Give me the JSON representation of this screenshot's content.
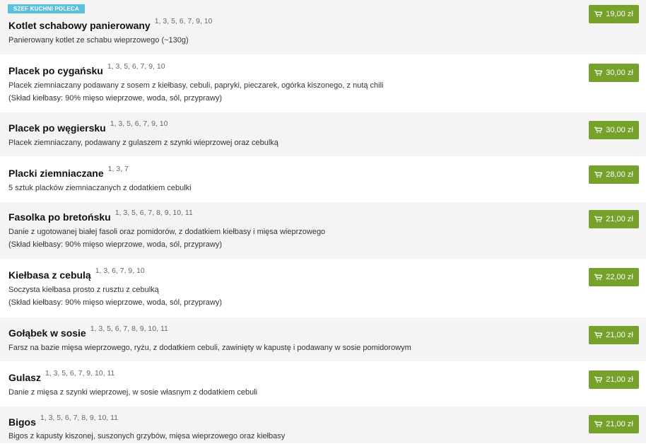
{
  "badge": "SZEF KUCHNI POLECA",
  "items": [
    {
      "name": "Kotlet schabowy panierowany",
      "allergens": "1, 3, 5, 6, 7, 9, 10",
      "desc": [
        "Panierowany kotlet ze schabu wieprzowego (~130g)"
      ],
      "price": "19,00 zł"
    },
    {
      "name": "Placek po cygańsku",
      "allergens": "1, 3, 5, 6, 7, 9, 10",
      "desc": [
        "Placek ziemniaczany podawany z sosem z kiełbasy, cebuli, papryki, pieczarek, ogórka kiszonego, z nutą chili",
        "(Skład kiełbasy: 90% mięso wieprzowe, woda, sól, przyprawy)"
      ],
      "price": "30,00 zł"
    },
    {
      "name": "Placek po węgiersku",
      "allergens": "1, 3, 5, 6, 7, 9, 10",
      "desc": [
        "Placek ziemniaczany, podawany z gulaszem z szynki wieprzowej oraz cebulką"
      ],
      "price": "30,00 zł"
    },
    {
      "name": "Placki ziemniaczane",
      "allergens": "1, 3, 7",
      "desc": [
        "5 sztuk placków ziemniaczanych z dodatkiem cebulki"
      ],
      "price": "28,00 zł"
    },
    {
      "name": "Fasolka po bretońsku",
      "allergens": "1, 3, 5, 6, 7, 8, 9, 10, 11",
      "desc": [
        "Danie z ugotowanej białej fasoli oraz pomidorów, z dodatkiem kiełbasy i mięsa wieprzowego",
        "(Skład kiełbasy: 90% mięso wieprzowe, woda, sól, przyprawy)"
      ],
      "price": "21,00 zł"
    },
    {
      "name": "Kiełbasa z cebulą",
      "allergens": "1, 3, 6, 7, 9, 10",
      "desc": [
        "Soczysta kiełbasa prosto z rusztu z cebulką",
        "(Skład kiełbasy: 90% mięso wieprzowe, woda, sól, przyprawy)"
      ],
      "price": "22,00 zł"
    },
    {
      "name": "Gołąbek w sosie",
      "allergens": "1, 3, 5, 6, 7, 8, 9, 10, 11",
      "desc": [
        "Farsz na bazie mięsa wieprzowego, ryżu, z dodatkiem cebuli, zawinięty w kapustę i podawany w sosie pomidorowym"
      ],
      "price": "21,00 zł"
    },
    {
      "name": "Gulasz",
      "allergens": "1, 3, 5, 6, 7, 9, 10, 11",
      "desc": [
        "Danie z mięsa z szynki wieprzowej, w sosie własnym z dodatkiem cebuli"
      ],
      "price": "21,00 zł"
    },
    {
      "name": "Bigos",
      "allergens": "1, 3, 5, 6, 7, 8, 9, 10, 11",
      "desc": [
        "Bigos z kapusty kiszonej, suszonych grzybów, mięsa wieprzowego oraz kiełbasy"
      ],
      "price": "21,00 zł"
    }
  ]
}
